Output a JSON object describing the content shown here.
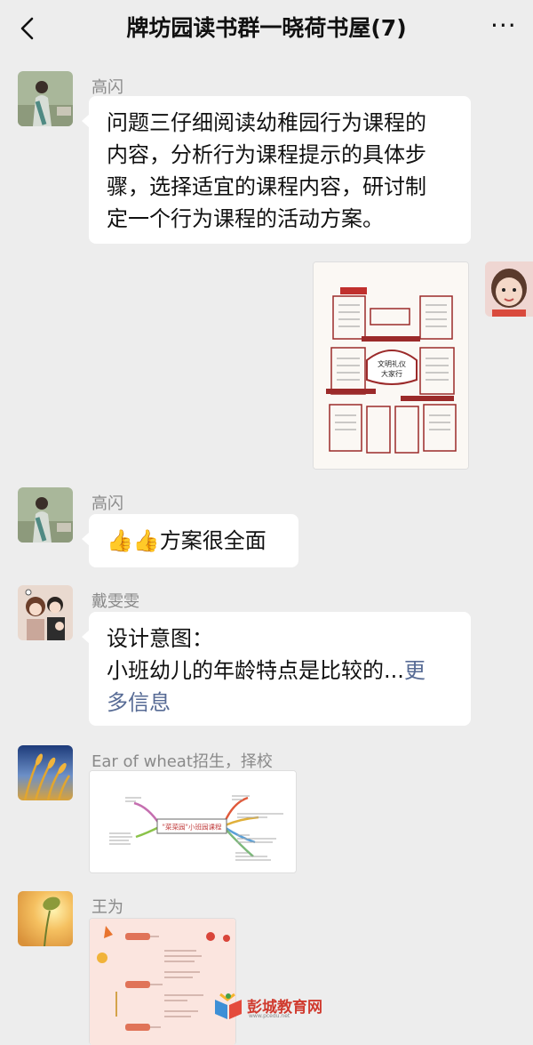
{
  "header": {
    "title": "牌坊园读书群一晓荷书屋(7)",
    "back_icon": "chevron-left-icon",
    "more_icon": "ellipsis-icon",
    "more_glyph": "···"
  },
  "messages": [
    {
      "sender": "高闪",
      "text": "问题三仔细阅读幼稚园行为课程的内容，分析行为课程提示的具体步骤，选择适宜的课程内容，研讨制定一个行为课程的活动方案。",
      "lines": [
        "问题三仔细阅读幼稚园行为课程的",
        "内容，分析行为课程提示的具体步",
        "骤，选择适宜的课程内容，研讨制",
        "定一个行为课程的活动方案。"
      ]
    },
    {
      "sender": "",
      "type": "image",
      "image_texts": [
        "文明礼仪",
        "大家行"
      ]
    },
    {
      "sender": "高闪",
      "text": "👍👍方案很全面",
      "emoji": "👍👍",
      "body": "方案很全面"
    },
    {
      "sender": "戴雯雯",
      "line1": "设计意图：",
      "line2": "小班幼儿的年龄特点是比较的...",
      "more_1": "更",
      "more_2": "多信息"
    },
    {
      "sender": "Ear of wheat招生，择校",
      "type": "image",
      "image_texts": [
        "\"菜菜园\"小班园课程"
      ]
    },
    {
      "sender": "王为",
      "type": "image"
    }
  ],
  "watermark": {
    "text": "彭城教育网",
    "sub": "www.pcedu.net"
  },
  "colors": {
    "background": "#ededed",
    "bubble": "#ffffff",
    "link": "#576b95",
    "sender": "#8a8a8a"
  }
}
